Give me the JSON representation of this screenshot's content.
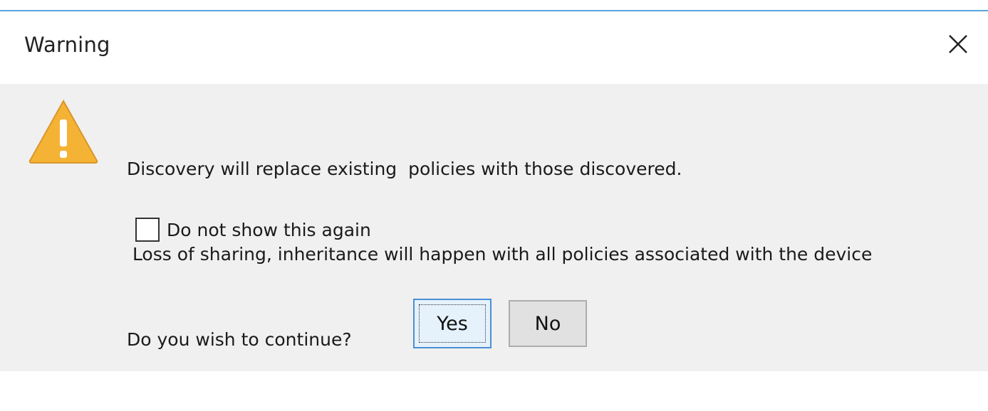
{
  "dialog": {
    "title": "Warning",
    "close_icon": "close-icon",
    "warning_icon": "warning-triangle-icon",
    "message_lines": [
      "Discovery will replace existing  policies with those discovered.",
      " Loss of sharing, inheritance will happen with all policies associated with the device",
      "Do you wish to continue?"
    ],
    "checkbox": {
      "label": "Do not show this again",
      "checked": false
    },
    "buttons": {
      "yes_label": "Yes",
      "no_label": "No"
    },
    "colors": {
      "accent": "#5aa6e0",
      "warning_fill": "#f5b335",
      "body_bg": "#f0f0f0"
    }
  }
}
